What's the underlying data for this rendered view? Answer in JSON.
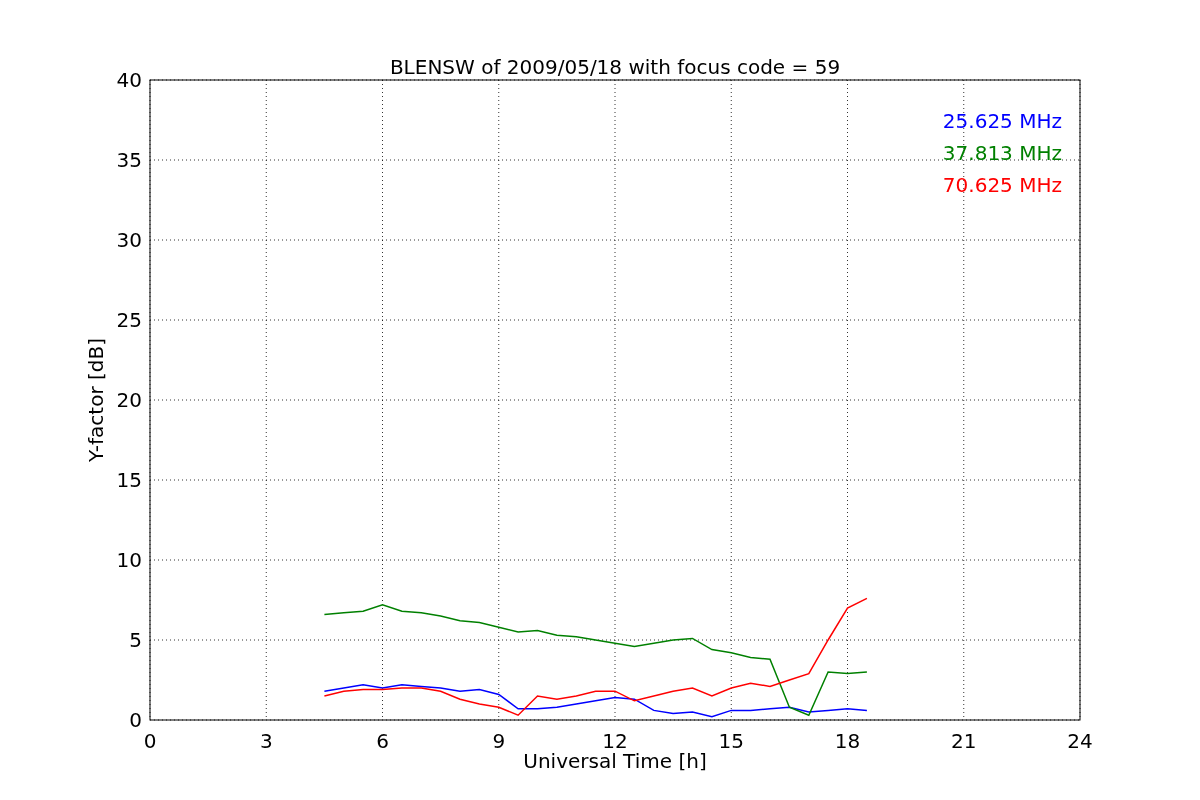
{
  "chart": {
    "chart_data": {
      "type": "line",
      "title": "BLENSW of 2009/05/18 with focus code = 59",
      "xlabel": "Universal Time [h]",
      "ylabel": "Y-factor [dB]",
      "x": [
        4.5,
        5,
        5.5,
        6,
        6.5,
        7,
        7.5,
        8,
        8.5,
        9,
        9.5,
        10,
        10.5,
        11,
        11.5,
        12,
        12.5,
        13,
        13.5,
        14,
        14.5,
        15,
        15.5,
        16,
        16.5,
        17,
        17.5,
        18,
        18.5
      ],
      "series": [
        {
          "name": "25.625 MHz",
          "color": "#0000ff",
          "values": [
            1.8,
            2.0,
            2.2,
            2.0,
            2.2,
            2.1,
            2.0,
            1.8,
            1.9,
            1.6,
            0.7,
            0.7,
            0.8,
            1.0,
            1.2,
            1.4,
            1.3,
            0.6,
            0.4,
            0.5,
            0.2,
            0.6,
            0.6,
            0.7,
            0.8,
            0.5,
            0.6,
            0.7,
            0.6
          ]
        },
        {
          "name": "37.813 MHz",
          "color": "#008000",
          "values": [
            6.6,
            6.7,
            6.8,
            7.2,
            6.8,
            6.7,
            6.5,
            6.2,
            6.1,
            5.8,
            5.5,
            5.6,
            5.3,
            5.2,
            5.0,
            4.8,
            4.6,
            4.8,
            5.0,
            5.1,
            4.4,
            4.2,
            3.9,
            3.8,
            0.8,
            0.3,
            3.0,
            2.9,
            3.0
          ]
        },
        {
          "name": "70.625 MHz",
          "color": "#ff0000",
          "values": [
            1.5,
            1.8,
            1.9,
            1.9,
            2.0,
            2.0,
            1.8,
            1.3,
            1.0,
            0.8,
            0.3,
            1.5,
            1.3,
            1.5,
            1.8,
            1.8,
            1.2,
            1.5,
            1.8,
            2.0,
            1.5,
            2.0,
            2.3,
            2.1,
            2.5,
            2.9,
            5.0,
            7.0,
            7.6
          ]
        }
      ],
      "xlim": [
        0,
        24
      ],
      "ylim": [
        0,
        40
      ],
      "xticks": [
        0,
        3,
        6,
        9,
        12,
        15,
        18,
        21,
        24
      ],
      "yticks": [
        0,
        5,
        10,
        15,
        20,
        25,
        30,
        35,
        40
      ],
      "grid": true
    }
  }
}
